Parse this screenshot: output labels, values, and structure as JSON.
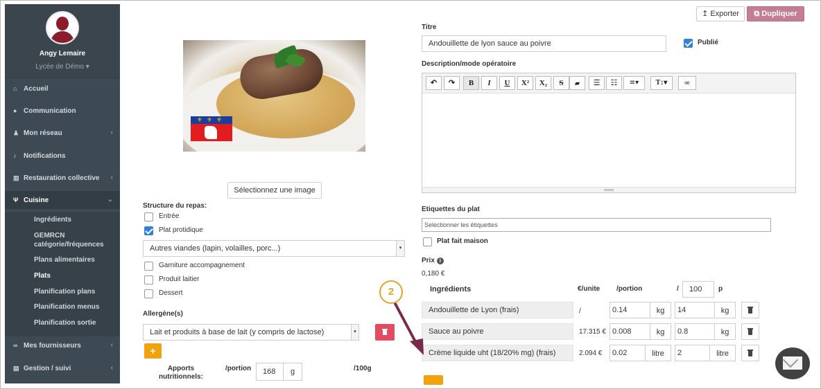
{
  "sidebar": {
    "user_name": "Angy Lemaire",
    "school": "Lycée de Démo",
    "school_caret": "▾",
    "items": [
      {
        "icon": "home-icon",
        "glyph": "⌂",
        "label": "Accueil"
      },
      {
        "icon": "comment-icon",
        "glyph": "●",
        "label": "Communication"
      },
      {
        "icon": "users-icon",
        "glyph": "♟",
        "label": "Mon réseau",
        "chevron": "‹"
      },
      {
        "icon": "bell-icon",
        "glyph": "♪",
        "label": "Notifications"
      },
      {
        "icon": "bank-icon",
        "glyph": "▥",
        "label": "Restauration collective",
        "chevron": "‹"
      },
      {
        "icon": "cutlery-icon",
        "glyph": "Ψ",
        "label": "Cuisine",
        "chevron": "⌄"
      },
      {
        "icon": "handshake-icon",
        "glyph": "∞",
        "label": "Mes fournisseurs",
        "chevron": "‹"
      },
      {
        "icon": "cart-icon",
        "glyph": "▤",
        "label": "Gestion / suivi",
        "chevron": "‹"
      }
    ],
    "subitems": [
      "Ingrédients",
      "GEMRCN catégorie/fréquences",
      "Plans alimentaires",
      "Plats",
      "Planification plans",
      "Planification menus",
      "Planification sortie"
    ]
  },
  "toolbar": {
    "export_label": "Exporter",
    "export_glyph": "↥",
    "duplicate_label": "Dupliquer",
    "duplicate_glyph": "⧉"
  },
  "left": {
    "select_image_label": "Sélectionnez une image",
    "structure_label": "Structure du repas:",
    "checkboxes": [
      {
        "label": "Entrée",
        "checked": false
      },
      {
        "label": "Plat protidique",
        "checked": true
      },
      {
        "label": "Garniture accompagnement",
        "checked": false
      },
      {
        "label": "Produit laitier",
        "checked": false
      },
      {
        "label": "Dessert",
        "checked": false
      }
    ],
    "category_select": "Autres viandes (lapin, volailles, porc...)",
    "flag_lilies": "⚜⚜⚜",
    "allergen_label": "Allergène(s)",
    "allergen_select": "Lait et produits à base de lait (y compris de lactose)",
    "plus": "+",
    "apports_label": "Apports nutritionnels:",
    "portion_label": "/portion",
    "portion_value": "168",
    "portion_unit": "g",
    "per100_label": "/100g"
  },
  "right": {
    "title_label": "Titre",
    "title_value": "Andouillette de lyon sauce au poivre",
    "published_label": "Publié",
    "published": true,
    "description_label": "Description/mode opératoire",
    "editor_buttons": [
      "↶",
      "↷",
      "B",
      "I",
      "U",
      "X²",
      "X₂",
      "S",
      "▰",
      "☰",
      "☷",
      "≡▾",
      "T↕▾",
      "∞"
    ],
    "tags_label": "Etiquettes du plat",
    "tags_placeholder": "Selectionner les étiquettes",
    "homemade_label": "Plat fait maison",
    "homemade": false,
    "price_label": "Prix",
    "price_info": "i",
    "price_value": "0,180 €",
    "ingredients_header": {
      "name": "Ingrédients",
      "unit_price": "€/unite",
      "portion": "/portion",
      "slash": "/",
      "count": "100",
      "p": "p"
    },
    "ingredients": [
      {
        "name": "Andouillette de Lyon (frais)",
        "unit_price": "/",
        "portion": "0.14",
        "portion_unit": "kg",
        "total": "14",
        "total_unit": "kg"
      },
      {
        "name": "Sauce au poivre",
        "unit_price": "17.315 €",
        "portion": "0.008",
        "portion_unit": "kg",
        "total": "0.8",
        "total_unit": "kg"
      },
      {
        "name": "Crème liquide uht (18/20% mg) (frais)",
        "unit_price": "2.094 €",
        "portion": "0.02",
        "portion_unit": "litre",
        "total": "2",
        "total_unit": "litre"
      }
    ]
  },
  "annotation": {
    "step": "2"
  },
  "colors": {
    "sidebar": "#3e4a53",
    "accent_blue": "#2f83d9",
    "orange": "#f1a20c",
    "danger": "#e34b62",
    "duplicate": "#c47d93",
    "annotation": "#e8a12a",
    "arrow": "#7c2a4a"
  }
}
